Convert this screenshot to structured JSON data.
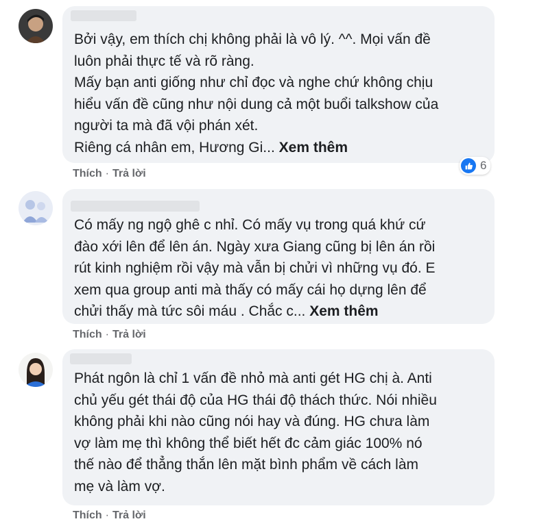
{
  "comments": [
    {
      "text": "Bởi vậy, em thích chị không phải là vô lý. ^^. Mọi vấn đề\nluôn phải thực tế và rõ ràng.\nMấy bạn anti giống như chỉ đọc và nghe chứ không chịu\nhiểu vấn đề cũng như nội dung cả một buổi talkshow của\nngười ta mà đã vội phán xét.\nRiêng cá nhân em, Hương Gi... ",
      "see_more": "Xem thêm",
      "like_label": "Thích",
      "reply_label": "Trả lời",
      "reaction_count": "6"
    },
    {
      "text": "Có mấy ng ngộ ghê c nhỉ. Có mấy vụ trong quá khứ cứ\nđào xới lên để lên án. Ngày xưa Giang cũng bị lên án rồi\nrút kinh nghiệm rồi vậy mà vẫn bị chửi vì những vụ đó. E\nxem qua group anti mà thấy có mấy cái họ dựng lên để\nchửi thấy mà tức sôi máu . Chắc c... ",
      "see_more": "Xem thêm",
      "like_label": "Thích",
      "reply_label": "Trả lời"
    },
    {
      "text": "Phát ngôn là chỉ 1 vấn đề nhỏ mà anti gét HG chị à. Anti\nchủ yếu gét thái độ của HG thái độ thách thức. Nói nhiều\nkhông phải khi nào cũng nói hay và đúng. HG chưa làm\nvợ làm mẹ thì không thể biết hết đc cảm giác 100% nó\nthế nào để thẳng thắn lên mặt bình phẩm về cách làm\nmẹ và làm vợ.",
      "like_label": "Thích",
      "reply_label": "Trả lời"
    }
  ],
  "colors": {
    "bubble": "#f0f2f5",
    "text": "#1c1e21",
    "meta": "#65676b",
    "like_blue": "#1877f2"
  },
  "icons": [
    "avatar-photo",
    "like-reaction-icon"
  ]
}
